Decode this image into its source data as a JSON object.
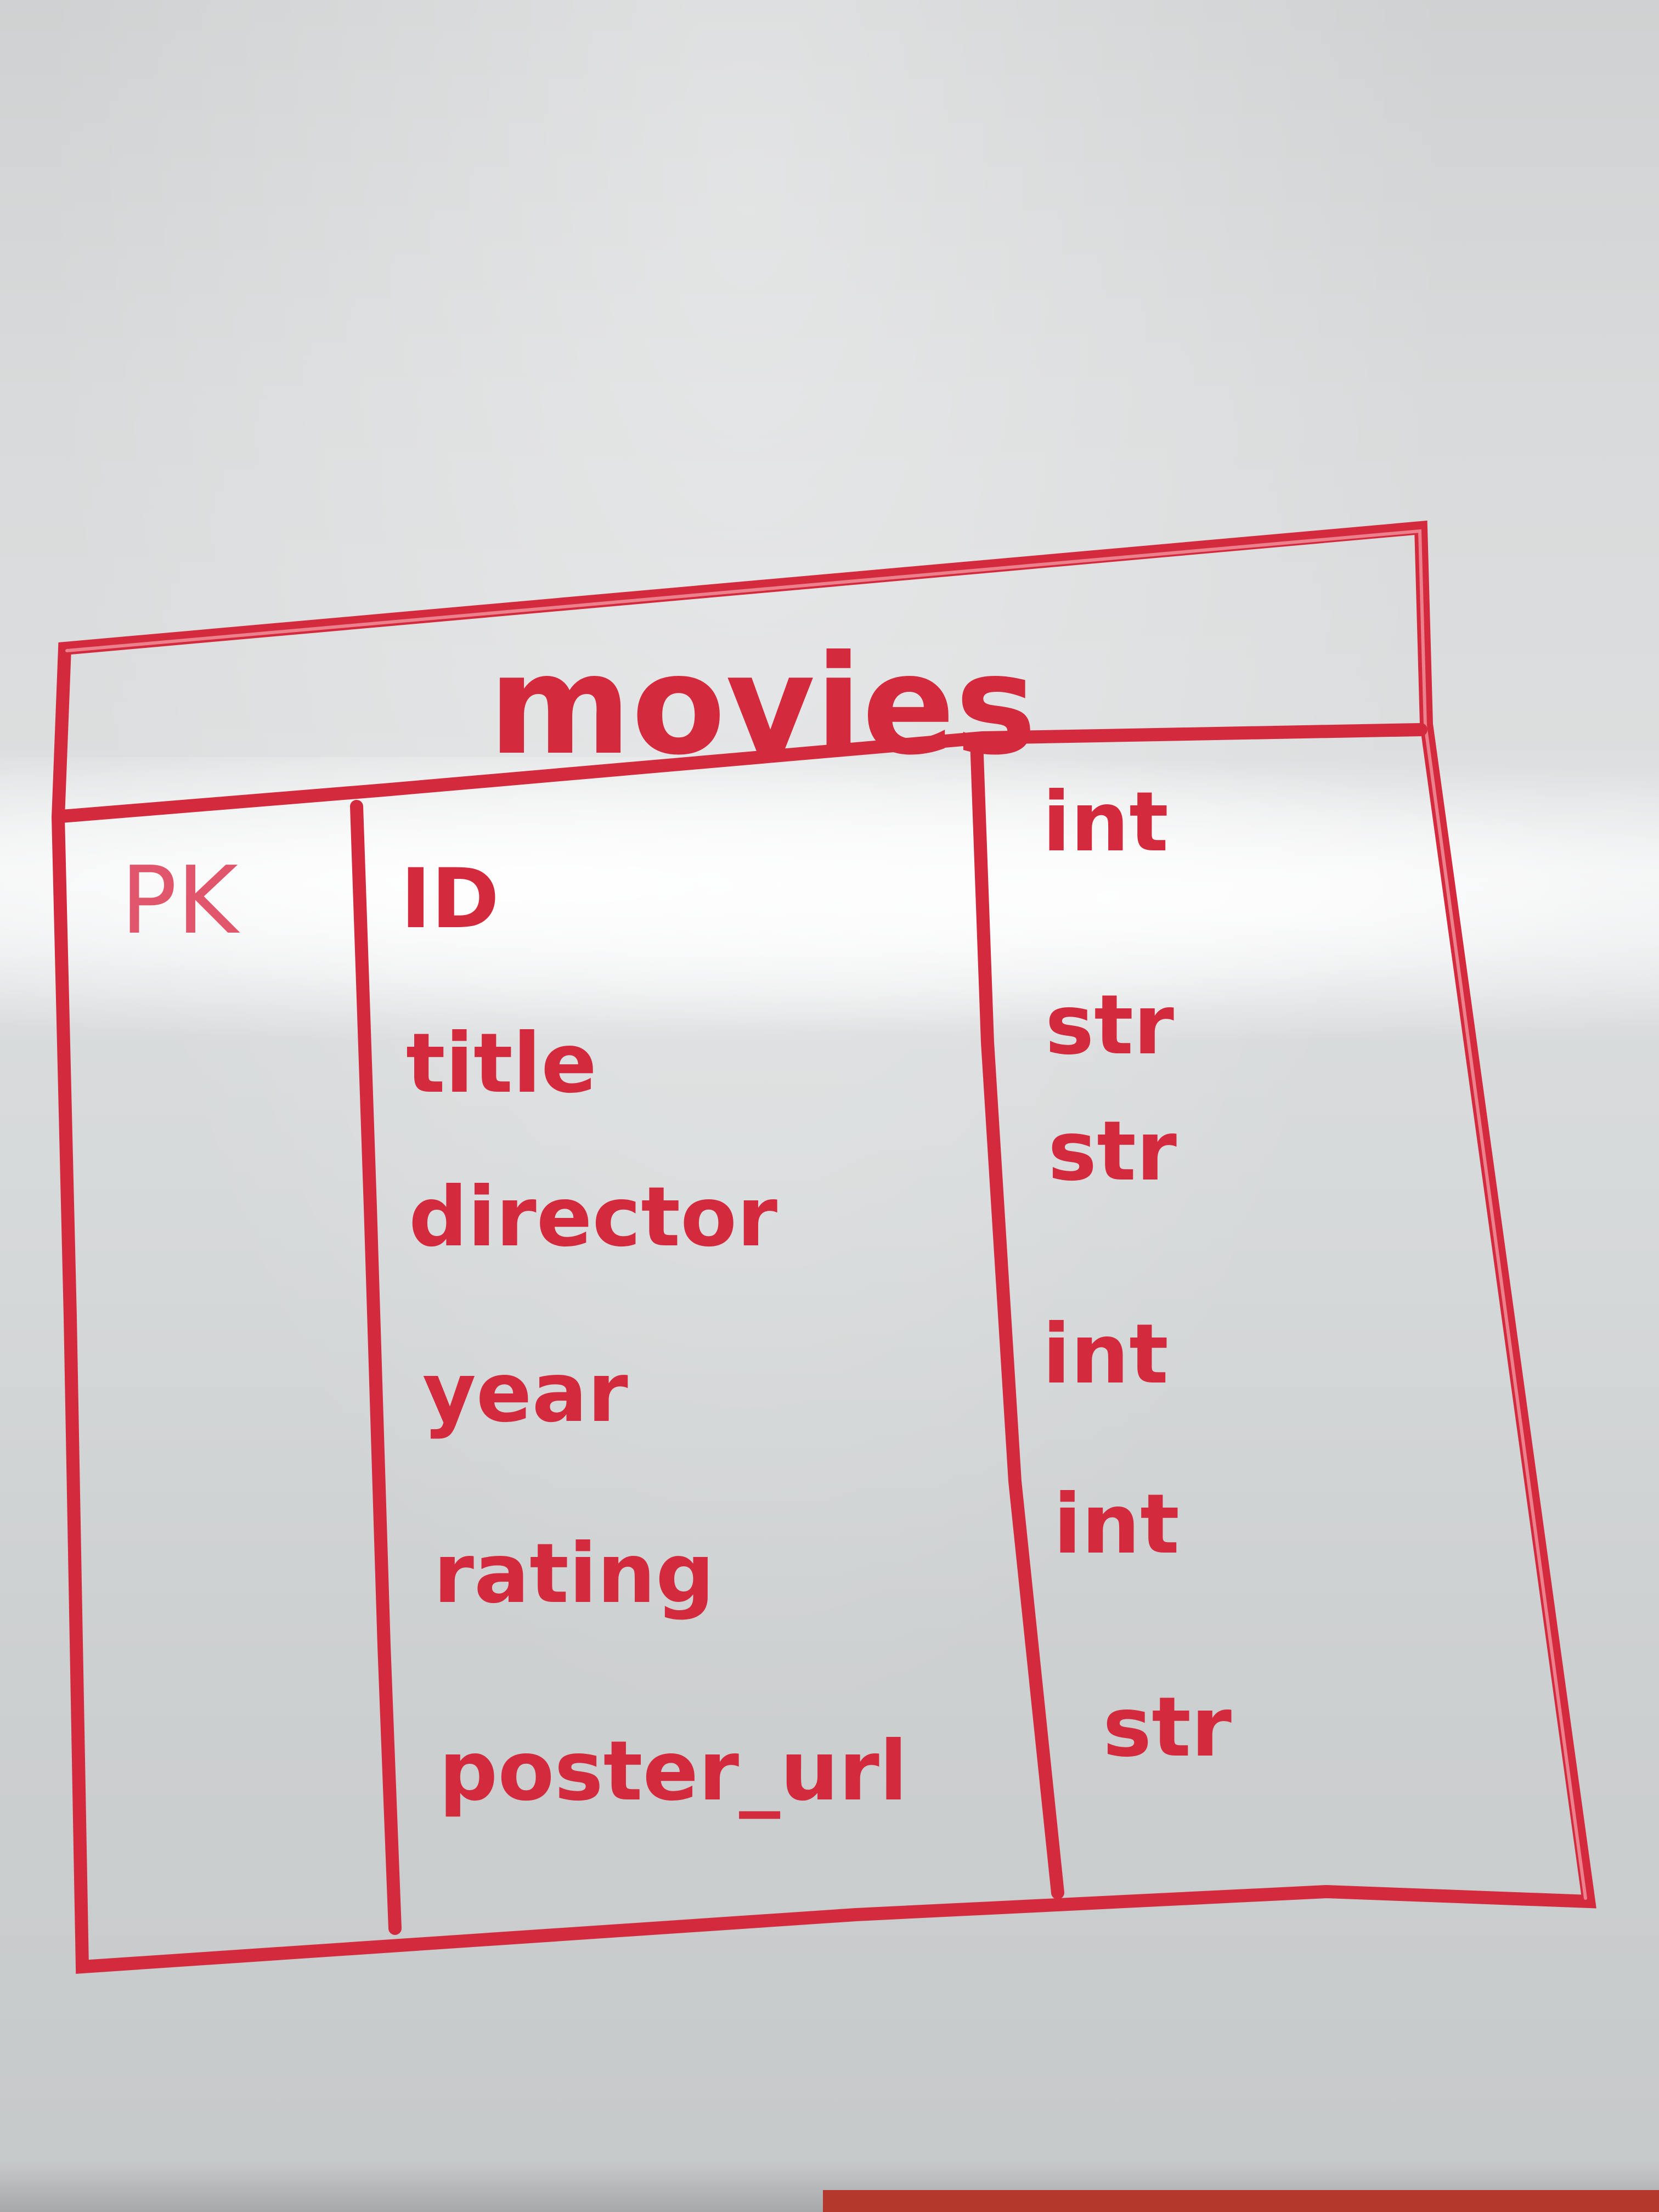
{
  "table": {
    "name": "movies",
    "key_label": "PK",
    "fields": [
      {
        "name": "ID",
        "type": "int"
      },
      {
        "name": "title",
        "type": "str"
      },
      {
        "name": "director",
        "type": "str"
      },
      {
        "name": "year",
        "type": "int"
      },
      {
        "name": "rating",
        "type": "int"
      },
      {
        "name": "poster_url",
        "type": "str"
      }
    ]
  },
  "colors": {
    "marker": "#d42a3e",
    "board": "#d8dadb"
  }
}
